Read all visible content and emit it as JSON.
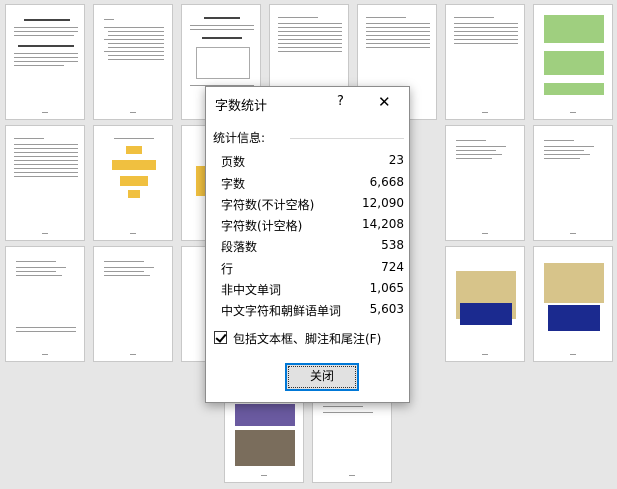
{
  "dialog": {
    "title": "字数统计",
    "help_label": "?",
    "close_label": "✕",
    "section_label": "统计信息:",
    "stats": [
      {
        "label": "页数",
        "value": "23"
      },
      {
        "label": "字数",
        "value": "6,668"
      },
      {
        "label": "字符数(不计空格)",
        "value": "12,090"
      },
      {
        "label": "字符数(计空格)",
        "value": "14,208"
      },
      {
        "label": "段落数",
        "value": "538"
      },
      {
        "label": "行",
        "value": "724"
      },
      {
        "label": "非中文单词",
        "value": "1,065"
      },
      {
        "label": "中文字符和朝鲜语单词",
        "value": "5,603"
      }
    ],
    "checkbox_label": "包括文本框、脚注和尾注(F)",
    "checkbox_checked": true,
    "close_button_label": "关闭"
  }
}
